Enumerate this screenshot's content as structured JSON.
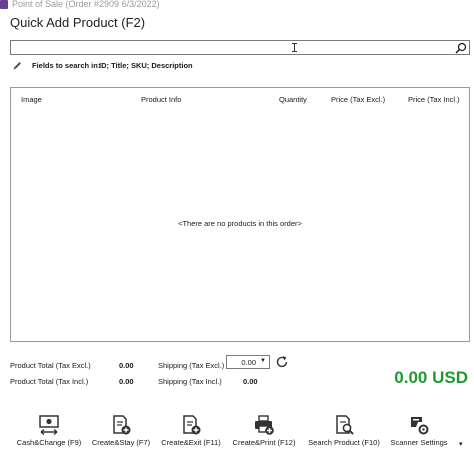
{
  "window": {
    "title": "Point of Sale (Order #2909 6/3/2022)"
  },
  "heading": "Quick Add Product (F2)",
  "search": {
    "value": ""
  },
  "fields": {
    "label": "Fields to search in:",
    "value": "ID; Title; SKU; Description"
  },
  "table": {
    "columns": [
      "Image",
      "Product Info",
      "Quantity",
      "Price (Tax Excl.)",
      "Price (Tax Incl.)"
    ],
    "empty_message": "<There are no products in this order>"
  },
  "totals": {
    "product_excl_label": "Product Total (Tax Excl.)",
    "product_excl_value": "0.00",
    "product_incl_label": "Product Total (Tax Incl.)",
    "product_incl_value": "0.00",
    "shipping_excl_label": "Shipping (Tax Excl.)",
    "shipping_excl_value": "0.00",
    "shipping_incl_label": "Shipping (Tax Incl.)",
    "shipping_incl_value": "0.00",
    "grand_total": "0.00 USD",
    "grand_total_color": "#1f9a2e"
  },
  "toolbar": {
    "buttons": [
      {
        "label": "Cash&Change (F9)",
        "icon": "cash-icon"
      },
      {
        "label": "Create&Stay (F7)",
        "icon": "document-add-icon"
      },
      {
        "label": "Create&Exit (F11)",
        "icon": "document-add-icon"
      },
      {
        "label": "Create&Print (F12)",
        "icon": "printer-add-icon"
      },
      {
        "label": "Search Product (F10)",
        "icon": "document-search-icon"
      },
      {
        "label": "Scanner Settings",
        "icon": "scanner-settings-icon"
      }
    ],
    "more": "▾"
  }
}
